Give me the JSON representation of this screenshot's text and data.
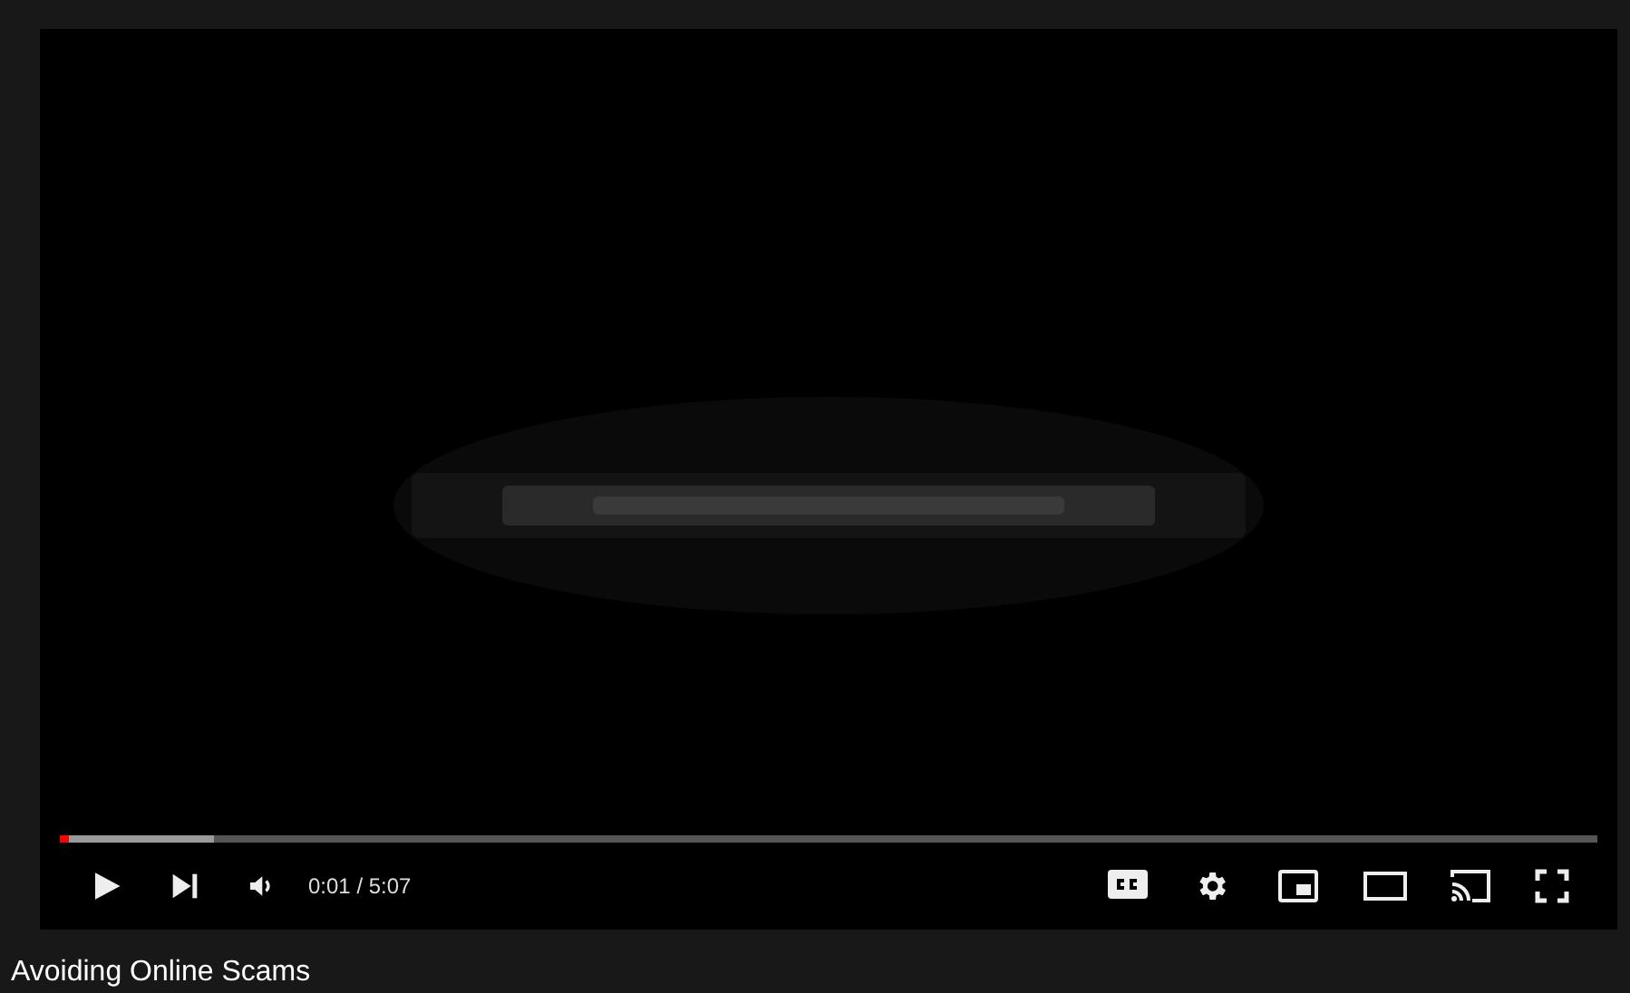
{
  "player": {
    "progress": {
      "level": 0.005
    },
    "buffer": {
      "level": 0.1
    },
    "time": "0:01 / 5:07",
    "captions": {
      "on": false
    }
  },
  "video_title": "Avoiding Online Scams"
}
